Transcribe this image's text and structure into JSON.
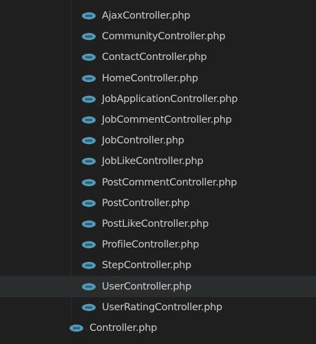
{
  "explorer": {
    "files": [
      {
        "name": "AjaxController.php",
        "icon": "php-file-icon",
        "level": 2
      },
      {
        "name": "CommunityController.php",
        "icon": "php-file-icon",
        "level": 2
      },
      {
        "name": "ContactController.php",
        "icon": "php-file-icon",
        "level": 2
      },
      {
        "name": "HomeController.php",
        "icon": "php-file-icon",
        "level": 2
      },
      {
        "name": "JobApplicationController.php",
        "icon": "php-file-icon",
        "level": 2
      },
      {
        "name": "JobCommentController.php",
        "icon": "php-file-icon",
        "level": 2
      },
      {
        "name": "JobController.php",
        "icon": "php-file-icon",
        "level": 2
      },
      {
        "name": "JobLikeController.php",
        "icon": "php-file-icon",
        "level": 2
      },
      {
        "name": "PostCommentController.php",
        "icon": "php-file-icon",
        "level": 2
      },
      {
        "name": "PostController.php",
        "icon": "php-file-icon",
        "level": 2
      },
      {
        "name": "PostLikeController.php",
        "icon": "php-file-icon",
        "level": 2
      },
      {
        "name": "ProfileController.php",
        "icon": "php-file-icon",
        "level": 2
      },
      {
        "name": "StepController.php",
        "icon": "php-file-icon",
        "level": 2
      },
      {
        "name": "UserController.php",
        "icon": "php-file-icon",
        "level": 2,
        "hovered": true
      },
      {
        "name": "UserRatingController.php",
        "icon": "php-file-icon",
        "level": 2
      },
      {
        "name": "Controller.php",
        "icon": "php-file-icon",
        "level": 1
      }
    ]
  },
  "colors": {
    "background": "#1f1f1f",
    "hover": "#2a2d2e",
    "text": "#cccccc",
    "php_icon": "#519aba"
  }
}
